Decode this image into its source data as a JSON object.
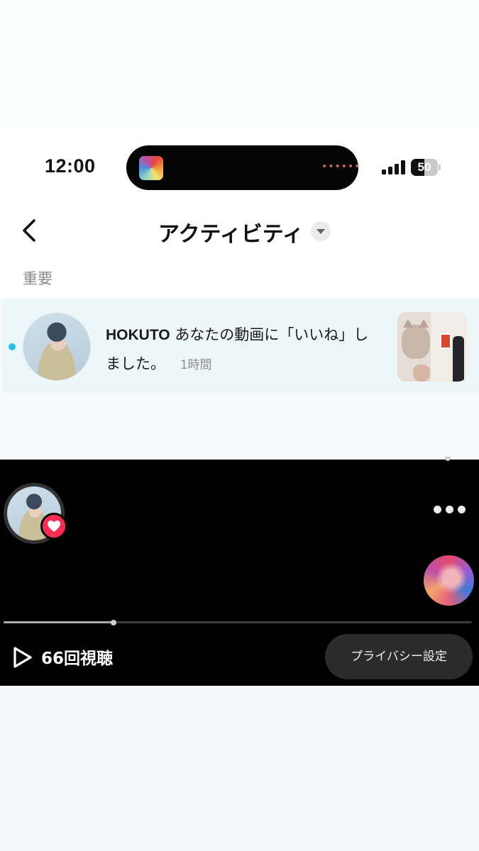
{
  "status_bar": {
    "time": "12:00",
    "battery": "50",
    "battery_level": 0.5
  },
  "header": {
    "title": "アクティビティ",
    "back_icon": "chevron-left-icon",
    "dropdown_icon": "caret-down-icon"
  },
  "section": {
    "label": "重要"
  },
  "activity": {
    "items": [
      {
        "username": "HOKUTO",
        "message": "あなたの動画に「いいね」しました。",
        "time": "1時間",
        "unread": true
      }
    ]
  },
  "video": {
    "views": "66回視聴",
    "privacy_button": "プライバシー設定",
    "progress": 0.235,
    "accent_color": "#fe2c55",
    "icons": [
      "heart-icon",
      "more-icon",
      "play-icon",
      "music-disc-icon"
    ]
  },
  "colors": {
    "unread_dot": "#25c1e6",
    "row_highlight": "#edf7fa"
  }
}
